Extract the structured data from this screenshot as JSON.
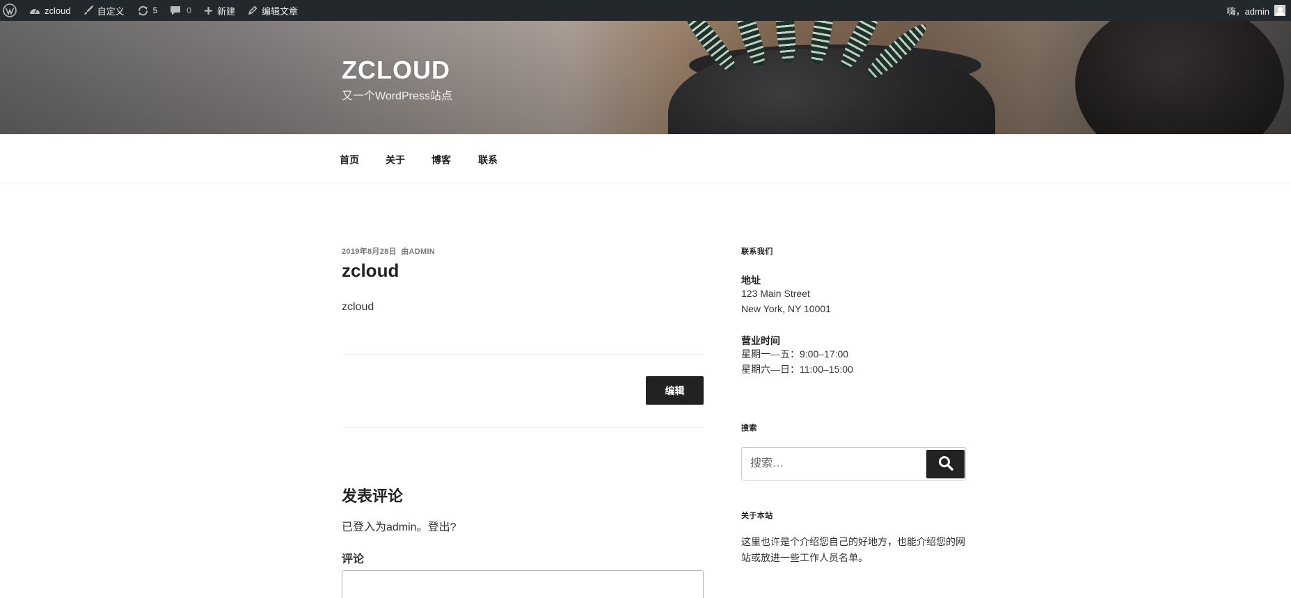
{
  "admin_bar": {
    "site_name": "zcloud",
    "customize": "自定义",
    "updates_count": "5",
    "comments_count": "0",
    "new": "新建",
    "edit_post": "编辑文章",
    "greeting": "嗨，admin"
  },
  "header": {
    "site_title": "ZCLOUD",
    "tagline": "又一个WordPress站点"
  },
  "nav": {
    "items": [
      "首页",
      "关于",
      "博客",
      "联系"
    ]
  },
  "post": {
    "date": "2019年8月28日",
    "by": "由",
    "author": "ADMIN",
    "title": "zcloud",
    "content": "zcloud",
    "edit_button": "编辑"
  },
  "comments": {
    "reply_title": "发表评论",
    "logged_in_prefix": "已登入为admin。",
    "logout_link": "登出?",
    "comment_label": "评论"
  },
  "sidebar": {
    "contact_title": "联系我们",
    "address_label": "地址",
    "address_line1": "123 Main Street",
    "address_line2": "New York, NY 10001",
    "hours_label": "营业时间",
    "hours_line1": "星期一—五：9:00–17:00",
    "hours_line2": "星期六—日：11:00–15:00",
    "search_title": "搜索",
    "search_placeholder": "搜索…",
    "about_title": "关于本站",
    "about_text": "这里也许是个介绍您自己的好地方，也能介绍您的网站或放进一些工作人员名单。"
  }
}
